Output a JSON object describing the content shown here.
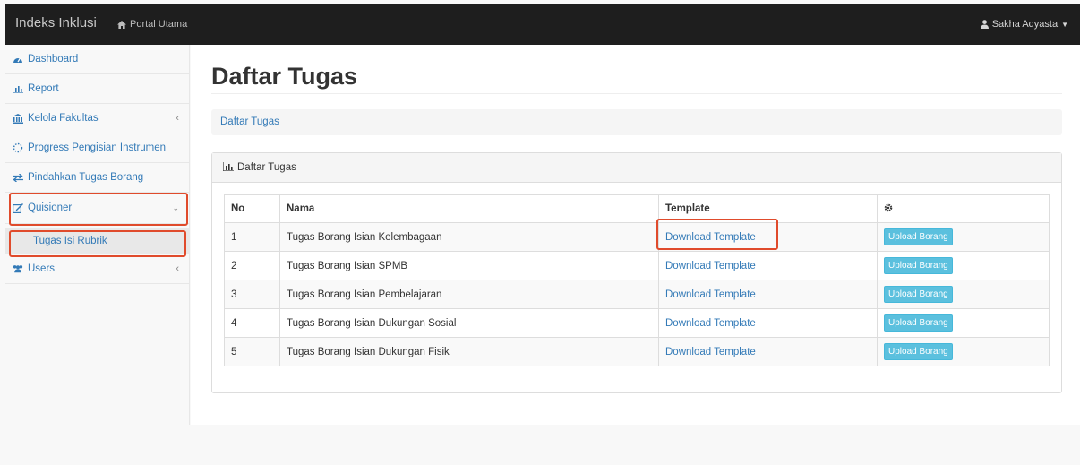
{
  "navbar": {
    "brand": "Indeks Inklusi",
    "portal_label": "Portal Utama",
    "user_label": "Sakha Adyasta"
  },
  "sidebar": {
    "items": [
      {
        "label": "Dashboard",
        "icon": "dashboard-icon"
      },
      {
        "label": "Report",
        "icon": "bar-chart-icon"
      },
      {
        "label": "Kelola Fakultas",
        "icon": "institution-icon"
      },
      {
        "label": "Progress Pengisian Instrumen",
        "icon": "spinner-icon"
      },
      {
        "label": "Pindahkan Tugas Borang",
        "icon": "exchange-icon"
      },
      {
        "label": "Quisioner",
        "icon": "edit-icon"
      },
      {
        "label": "Users",
        "icon": "users-icon"
      }
    ],
    "sub_items": [
      {
        "label": "Tugas Isi Rubrik"
      }
    ]
  },
  "main": {
    "title": "Daftar Tugas",
    "breadcrumb": "Daftar Tugas",
    "panel_title": "Daftar Tugas",
    "table": {
      "headers": [
        "No",
        "Nama",
        "Template"
      ],
      "rows": [
        {
          "no": "1",
          "nama": "Tugas Borang Isian Kelembagaan",
          "template": "Download Template",
          "action": "Upload Borang"
        },
        {
          "no": "2",
          "nama": "Tugas Borang Isian SPMB",
          "template": "Download Template",
          "action": "Upload Borang"
        },
        {
          "no": "3",
          "nama": "Tugas Borang Isian Pembelajaran",
          "template": "Download Template",
          "action": "Upload Borang"
        },
        {
          "no": "4",
          "nama": "Tugas Borang Isian Dukungan Sosial",
          "template": "Download Template",
          "action": "Upload Borang"
        },
        {
          "no": "5",
          "nama": "Tugas Borang Isian Dukungan Fisik",
          "template": "Download Template",
          "action": "Upload Borang"
        }
      ]
    }
  },
  "colors": {
    "navbar_bg": "#1e1e1e",
    "link": "#337ab7",
    "upload_button": "#5bc0de",
    "highlight": "#e04b2c"
  }
}
